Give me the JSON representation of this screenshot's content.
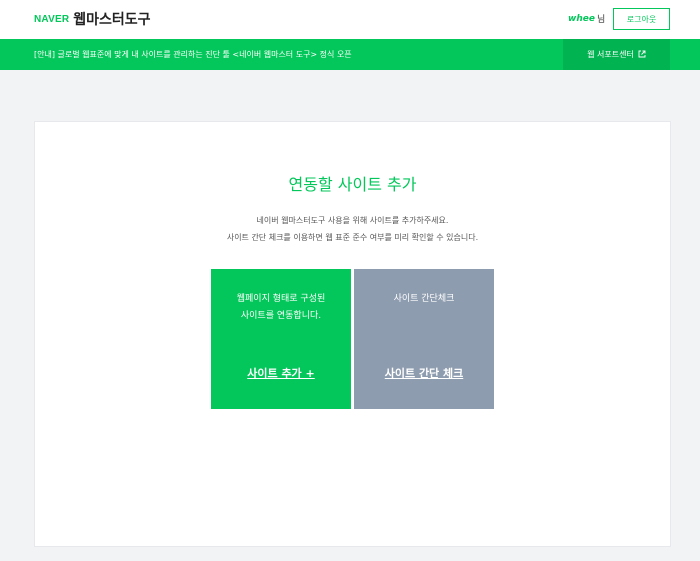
{
  "header": {
    "logo_naver": "NAVER",
    "logo_product": "웹마스터도구",
    "user_id": "whee",
    "user_suffix": "님",
    "logout_label": "로그아웃"
  },
  "notice": {
    "text": "[안내] 글로벌 웹표준에 맞게 내 사이트를 관리하는 진단 툴 <네이버 웹마스터 도구> 정식 오픈",
    "support_label": "웹 서포트센터",
    "support_icon": "external-link-icon"
  },
  "main": {
    "title": "연동할 사이트 추가",
    "desc_line1": "네이버 웹마스터도구 사용을 위해 사이트를 추가하주세요.",
    "desc_line2": "사이트 간단 체크를 이용하면 웹 표준 준수 여부를 미리 확인할 수 있습니다.",
    "add_tile": {
      "line1": "웹페이지 형태로 구성된",
      "line2": "사이트를 연동합니다.",
      "link": "사이트 추가 +"
    },
    "check_tile": {
      "line1": "사이트 간단체크",
      "link": "사이트 간단 체크"
    }
  },
  "colors": {
    "accent": "#03c75a",
    "tile_gray": "#8e9caf",
    "background": "#f2f3f5"
  }
}
